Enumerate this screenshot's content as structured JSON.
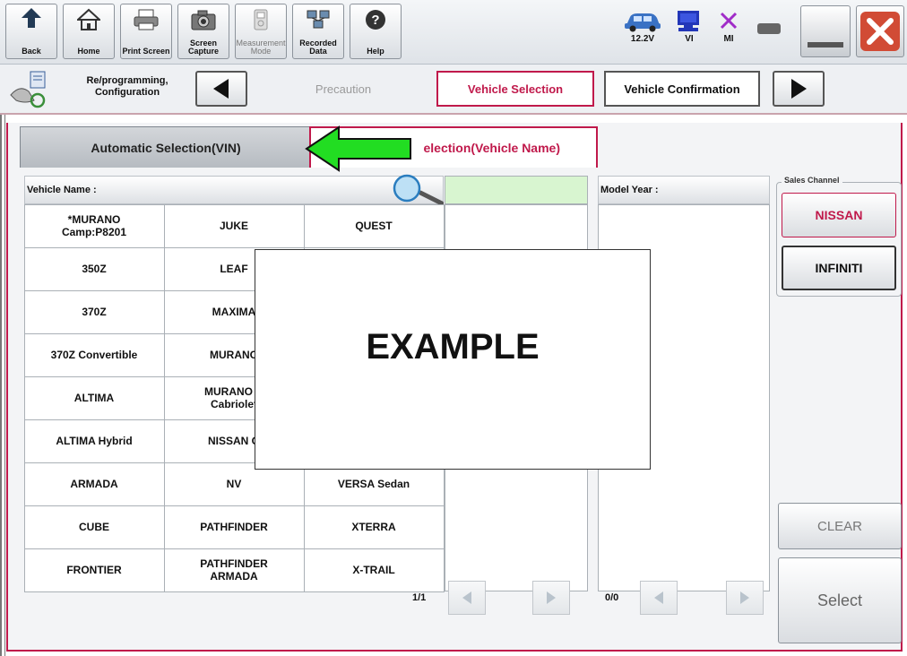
{
  "toolbar": {
    "buttons": [
      {
        "label": "Back"
      },
      {
        "label": "Home"
      },
      {
        "label": "Print Screen"
      },
      {
        "label1": "Screen",
        "label2": "Capture"
      },
      {
        "label1": "Measurement",
        "label2": "Mode"
      },
      {
        "label1": "Recorded",
        "label2": "Data"
      },
      {
        "label": "Help"
      }
    ],
    "status": {
      "voltage": "12.2V",
      "vi": "VI",
      "mi": "MI"
    }
  },
  "nav": {
    "function_line1": "Re/programming,",
    "function_line2": "Configuration",
    "steps": [
      "Precaution",
      "Vehicle Selection",
      "Vehicle Confirmation"
    ],
    "active_step": "Vehicle Selection"
  },
  "tabs": {
    "vin": "Automatic Selection(VIN)",
    "name_visible": "election(Vehicle Name)"
  },
  "vehicle_list": {
    "header_label": "Vehicle Name :",
    "rows": [
      [
        "*MURANO\nCamp:P8201",
        "JUKE",
        "QUEST"
      ],
      [
        "350Z",
        "LEAF",
        ""
      ],
      [
        "370Z",
        "MAXIMA",
        ""
      ],
      [
        "370Z Convertible",
        "MURANO",
        ""
      ],
      [
        "ALTIMA",
        "MURANO C\nCabriolet",
        ""
      ],
      [
        "ALTIMA Hybrid",
        "NISSAN G",
        ""
      ],
      [
        "ARMADA",
        "NV",
        "VERSA Sedan"
      ],
      [
        "CUBE",
        "PATHFINDER",
        "XTERRA"
      ],
      [
        "FRONTIER",
        "PATHFINDER\nARMADA",
        "X-TRAIL"
      ]
    ],
    "page": "1/1"
  },
  "model_year": {
    "header_label": "Model Year :",
    "page": "0/0"
  },
  "sales_channel": {
    "label": "Sales Channel",
    "options": [
      "NISSAN",
      "INFINITI"
    ],
    "selected": "NISSAN"
  },
  "actions": {
    "clear": "CLEAR",
    "select": "Select"
  },
  "overlay": {
    "text": "EXAMPLE"
  },
  "colors": {
    "accent": "#c0194b",
    "arrow_green": "#22dd22",
    "search_field": "#d8f5d0"
  }
}
